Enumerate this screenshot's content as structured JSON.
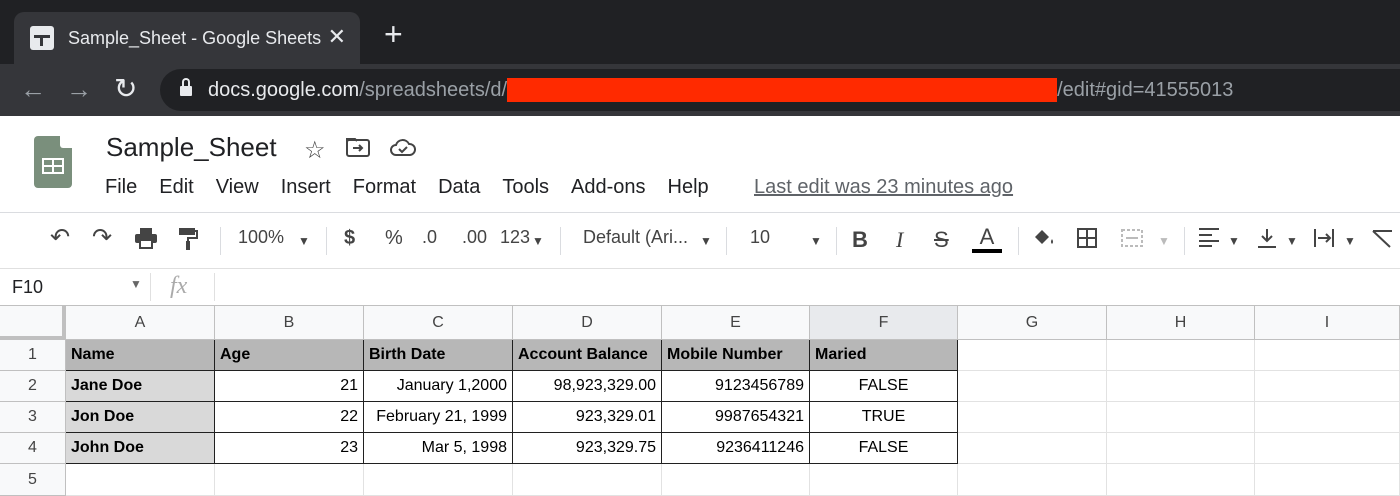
{
  "browser": {
    "tab_title": "Sample_Sheet - Google Sheets",
    "tab_close": "✕",
    "new_tab": "+",
    "url_host": "docs.google.com",
    "url_path_before": "/spreadsheets/d/",
    "url_path_after": "/edit#gid=41555013"
  },
  "sheets": {
    "title": "Sample_Sheet",
    "menu": [
      "File",
      "Edit",
      "View",
      "Insert",
      "Format",
      "Data",
      "Tools",
      "Add-ons",
      "Help"
    ],
    "last_edit": "Last edit was 23 minutes ago"
  },
  "toolbar": {
    "zoom": "100%",
    "currency": "$",
    "percent": "%",
    "decrease_decimals": ".0",
    "increase_decimals": ".00",
    "more_formats": "123",
    "font": "Default (Ari...",
    "font_size": "10",
    "bold": "B",
    "italic": "I",
    "strikethrough": "S",
    "text_color": "A"
  },
  "formula_bar": {
    "cell_ref": "F10",
    "fx": "fx"
  },
  "columns": [
    "A",
    "B",
    "C",
    "D",
    "E",
    "F",
    "G",
    "H",
    "I"
  ],
  "rows": [
    "1",
    "2",
    "3",
    "4",
    "5"
  ],
  "table": {
    "headers": [
      "Name",
      "Age",
      "Birth Date",
      "Account Balance",
      "Mobile Number",
      "Maried"
    ],
    "rows": [
      [
        "Jane Doe",
        "21",
        "January 1,2000",
        "98,923,329.00",
        "9123456789",
        "FALSE"
      ],
      [
        "Jon Doe",
        "22",
        "February 21, 1999",
        "923,329.01",
        "9987654321",
        "TRUE"
      ],
      [
        "John Doe",
        "23",
        "Mar 5, 1998",
        "923,329.75",
        "9236411246",
        "FALSE"
      ]
    ]
  },
  "colors": {
    "chrome_dark": "#202124",
    "header_fill": "#b7b7b7",
    "name_fill": "#d9d9d9",
    "redaction": "#ff2a00"
  }
}
